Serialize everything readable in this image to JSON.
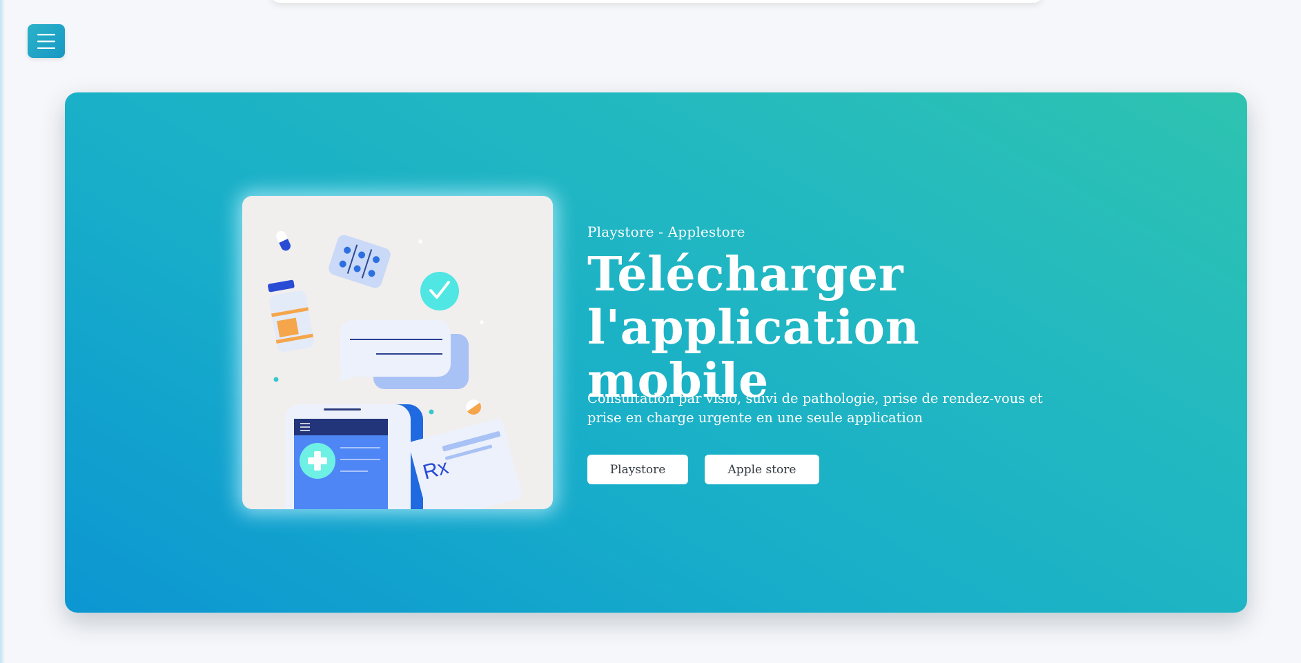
{
  "menu": {
    "icon": "hamburger-menu-icon",
    "accent_color": "#1fa8c6"
  },
  "hero": {
    "gradient_colors": [
      "#0c96d2",
      "#18aec9",
      "#2ec3b0"
    ],
    "eyebrow": "Playstore - Applestore",
    "headline": "Télécharger l'application mobile",
    "description": "Consultation par visio, suivi de pathologie, prise de rendez-vous et prise en charge urgente en une seule application",
    "buttons": {
      "playstore_label": "Playstore",
      "applestore_label": "Apple store"
    },
    "illustration": {
      "icons": [
        "capsule-icon",
        "pill-blister-icon",
        "checkmark-icon",
        "medicine-bottle-icon",
        "chat-bubble-icon",
        "phone-icon",
        "medical-cross-icon",
        "prescription-icon",
        "half-pill-icon"
      ],
      "prescription_text": "Rx"
    }
  }
}
